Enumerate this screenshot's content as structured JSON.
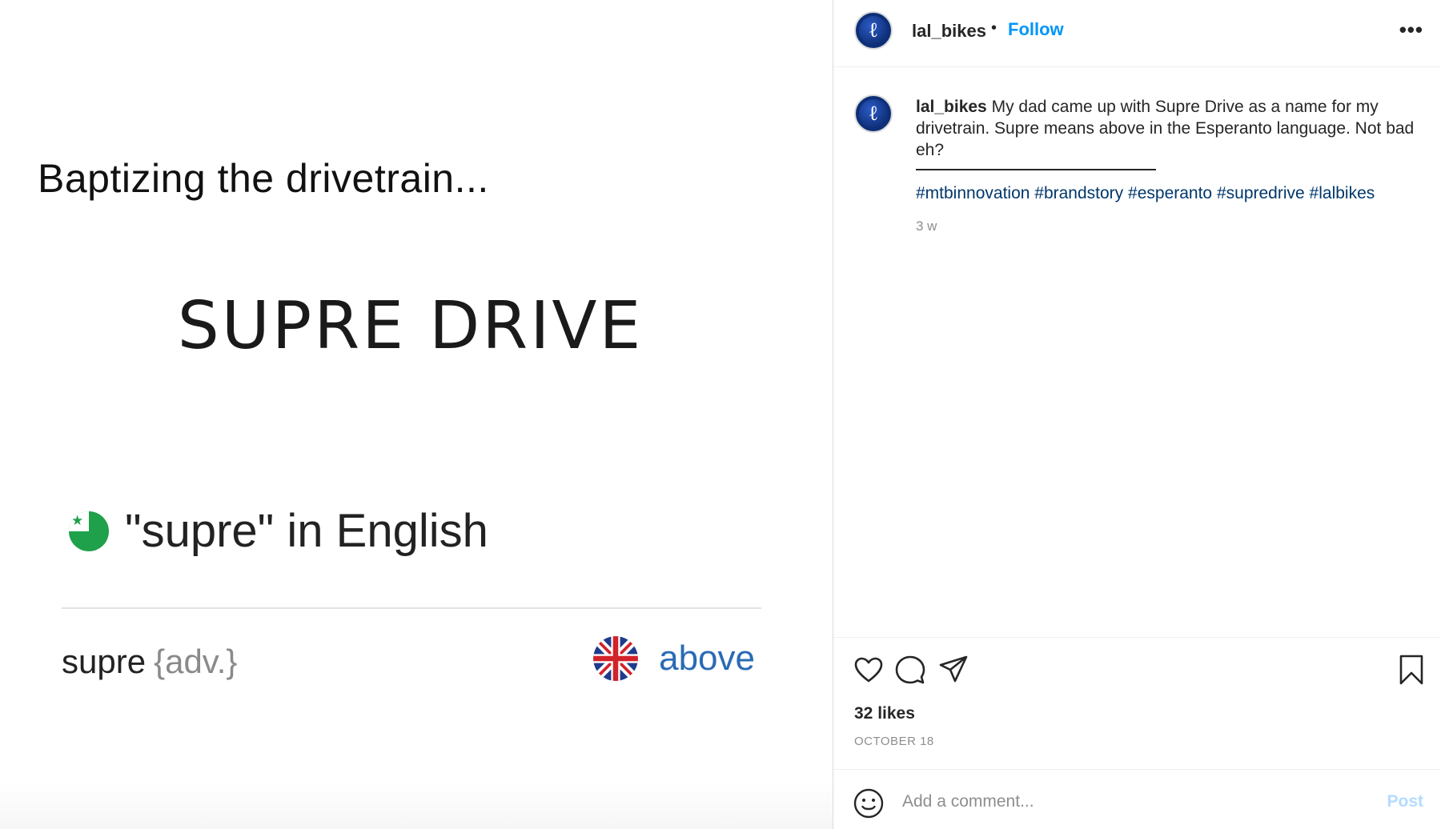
{
  "image": {
    "heading": "Baptizing the drivetrain...",
    "title": "SUPRE DRIVE",
    "esperanto_line": "\"supre\" in English",
    "dict_word": "supre",
    "dict_pos": "{adv.}",
    "translation": "above",
    "colors": {
      "esperanto_green": "#1fa04a",
      "translation_blue": "#2a6bb5"
    }
  },
  "header": {
    "username": "lal_bikes",
    "separator": "•",
    "follow_label": "Follow",
    "more_label": "•••"
  },
  "caption": {
    "username": "lal_bikes",
    "text": "My dad came up with Supre Drive as a name for my drivetrain. Supre means above in the Esperanto language. Not bad eh?",
    "hashtags": [
      "#mtbinnovation",
      "#brandstory",
      "#esperanto",
      "#supredrive",
      "#lalbikes"
    ],
    "time": "3 w"
  },
  "actions": {
    "icons": [
      "heart-icon",
      "comment-icon",
      "share-icon",
      "bookmark-icon"
    ]
  },
  "likes": "32 likes",
  "date": "OCTOBER 18",
  "comment": {
    "placeholder": "Add a comment...",
    "post_label": "Post"
  },
  "colors": {
    "link": "#0095f6",
    "hashtag": "#00376b",
    "post_disabled": "#b3dbff",
    "avatar_bg": "#0d2f78"
  }
}
